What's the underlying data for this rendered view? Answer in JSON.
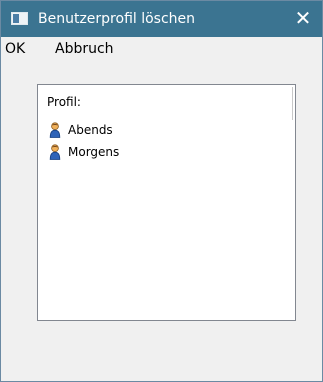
{
  "window": {
    "title": "Benutzerprofil löschen",
    "close_glyph": "✕",
    "app_icon": "window-icon",
    "accent_color": "#3b7491"
  },
  "menu": {
    "ok_label": "OK",
    "cancel_label": "Abbruch"
  },
  "profile_list": {
    "label": "Profil:",
    "items": [
      {
        "label": "Abends",
        "icon": "user-icon"
      },
      {
        "label": "Morgens",
        "icon": "user-icon"
      }
    ]
  }
}
